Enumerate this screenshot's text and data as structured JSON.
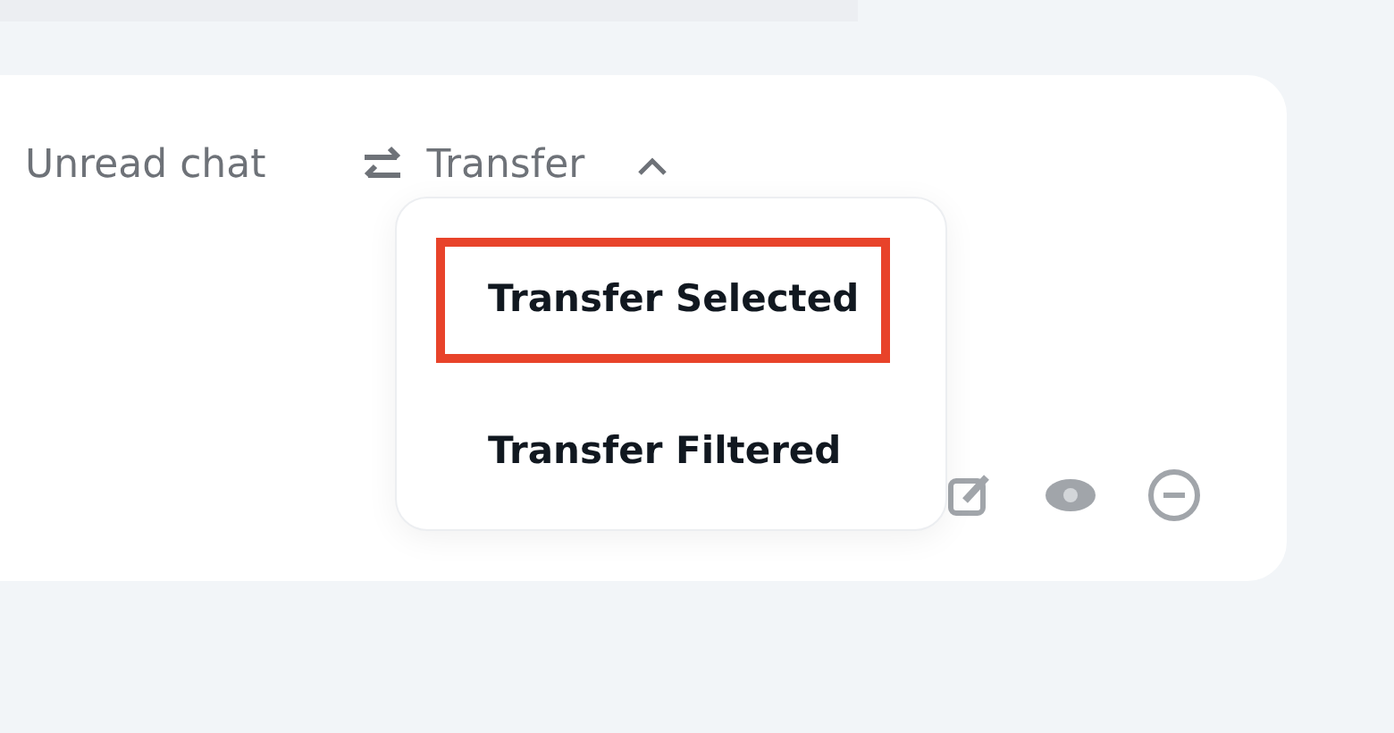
{
  "toolbar": [
    {
      "label": "Unread chat",
      "kind": "text"
    },
    {
      "label": "Transfer",
      "kind": "menu",
      "expanded": true
    }
  ],
  "transfer_menu": [
    {
      "label": "Transfer Selected",
      "highlighted": true
    },
    {
      "label": "Transfer Filtered",
      "highlighted": false
    }
  ]
}
